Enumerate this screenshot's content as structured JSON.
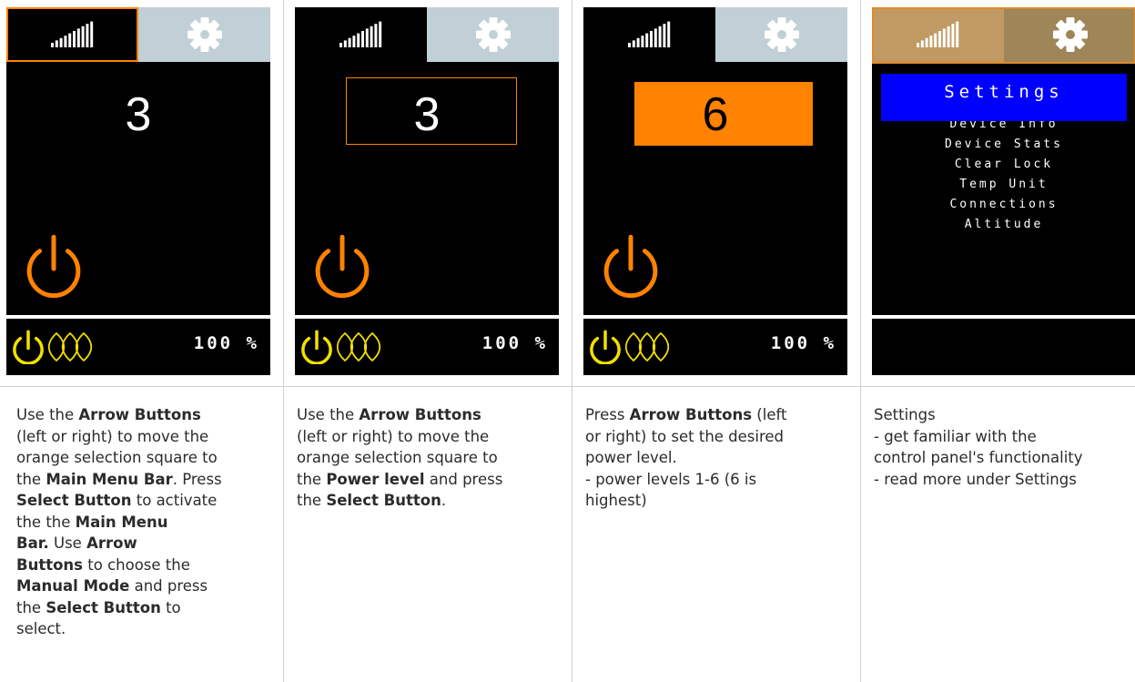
{
  "panels": [
    {
      "power_level": "3",
      "battery": "100 %"
    },
    {
      "power_level": "3",
      "battery": "100 %"
    },
    {
      "power_level": "6",
      "battery": "100 %"
    },
    {
      "menu_title": "Settings",
      "menu_items": [
        "Device Info",
        "Device Stats",
        "Clear Lock",
        "Temp Unit",
        "Connections",
        "Altitude"
      ]
    }
  ],
  "descriptions": [
    {
      "lines": [
        [
          "Use the ",
          {
            "b": "Arrow Buttons"
          }
        ],
        [
          "(left or right) to move the"
        ],
        [
          "orange selection square to"
        ],
        [
          "the ",
          {
            "b": "Main Menu Bar"
          },
          ". Press"
        ],
        [
          {
            "b": "Select Button"
          },
          " to activate"
        ],
        [
          "the the ",
          {
            "b": "Main Menu"
          }
        ],
        [
          {
            "b": "Bar."
          },
          " Use ",
          {
            "b": "Arrow"
          }
        ],
        [
          {
            "b": "Buttons"
          },
          " to choose the"
        ],
        [
          {
            "b": "Manual Mode"
          },
          " and press"
        ],
        [
          "the ",
          {
            "b": "Select Button"
          },
          " to"
        ],
        [
          "select."
        ]
      ]
    },
    {
      "lines": [
        [
          "Use the ",
          {
            "b": "Arrow Buttons"
          }
        ],
        [
          "(left or right) to move the"
        ],
        [
          "orange selection square to"
        ],
        [
          "the ",
          {
            "b": "Power level"
          },
          " and press"
        ],
        [
          "the ",
          {
            "b": "Select Button"
          },
          "."
        ]
      ]
    },
    {
      "lines": [
        [
          "Press ",
          {
            "b": "Arrow Buttons"
          },
          " (left"
        ],
        [
          "or right) to set the desired"
        ],
        [
          "power level."
        ],
        [
          "- power levels 1-6  (6 is"
        ],
        [
          "highest)"
        ]
      ]
    },
    {
      "lines": [
        [
          "Settings"
        ],
        [
          "- get familiar with the"
        ],
        [
          "control panel's functionality"
        ],
        [
          "- read more under Settings"
        ]
      ]
    }
  ],
  "colors": {
    "accent_orange": "#ff8200",
    "status_yellow": "#f2e000",
    "menu_blue": "#0000ff",
    "gear_tab": "#c1cfd6"
  },
  "icons": [
    "signal-bars-icon",
    "gear-icon",
    "power-icon",
    "heat-waves-icon"
  ]
}
